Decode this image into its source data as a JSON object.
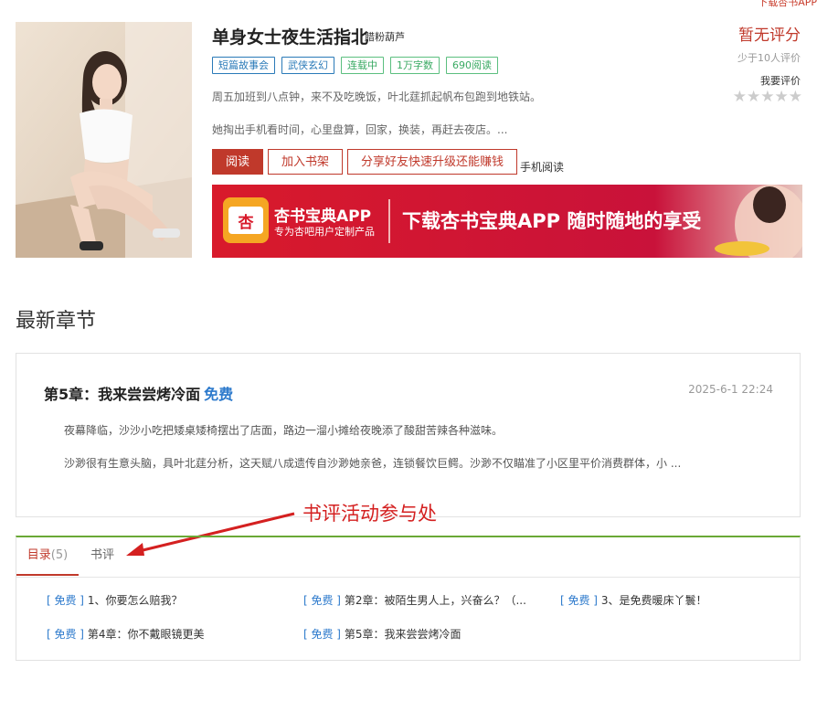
{
  "top_link": "下载杏书APP",
  "book": {
    "title": "单身女士夜生活指北",
    "author": "腊粉葫芦",
    "tags": [
      "短篇故事会",
      "武侠玄幻",
      "连载中",
      "1万字数",
      "690阅读"
    ],
    "desc1": "周五加班到八点钟，来不及吃晚饭，叶北莛抓起帆布包跑到地铁站。",
    "desc2": "她掏出手机看时间，心里盘算，回家，换装，再赶去夜店。..."
  },
  "buttons": {
    "read": "阅读",
    "shelf": "加入书架",
    "share": "分享好友快速升级还能赚钱",
    "mobile": "手机阅读"
  },
  "banner": {
    "app_name": "杏书宝典APP",
    "app_sub": "专为杏吧用户定制产品",
    "slogan": "下载杏书宝典APP 随时随地的享受",
    "logo_char": "杏"
  },
  "rating": {
    "score": "暂无评分",
    "fewer": "少于10人评价",
    "rate_link": "我要评价",
    "stars": "★★★★★"
  },
  "latest": {
    "section_title": "最新章节",
    "chapter_title": "第5章：我来尝尝烤冷面",
    "free": "免费",
    "date": "2025-6-1 22:24",
    "p1": "夜幕降临，沙沙小吃把矮桌矮椅摆出了店面，路边一溜小摊给夜晚添了酸甜苦辣各种滋味。",
    "p2": "沙渺很有生意头脑，具叶北莛分析，这天赋八成遗传自沙渺她亲爸，连锁餐饮巨鳄。沙渺不仅瞄准了小区里平价消费群体，小 ..."
  },
  "annotation": "书评活动参与处",
  "tabs": {
    "toc": "目录",
    "count": "(5)",
    "review": "书评"
  },
  "toc": [
    {
      "tag": "[ 免费 ]",
      "title": "1、你要怎么赔我？"
    },
    {
      "tag": "[ 免费 ]",
      "title": "第2章：被陌生男人上，兴奋么？（..."
    },
    {
      "tag": "[ 免费 ]",
      "title": "3、是免费暖床丫鬟！"
    },
    {
      "tag": "[ 免费 ]",
      "title": "第4章：你不戴眼镜更美"
    },
    {
      "tag": "[ 免费 ]",
      "title": "第5章：我来尝尝烤冷面"
    }
  ]
}
